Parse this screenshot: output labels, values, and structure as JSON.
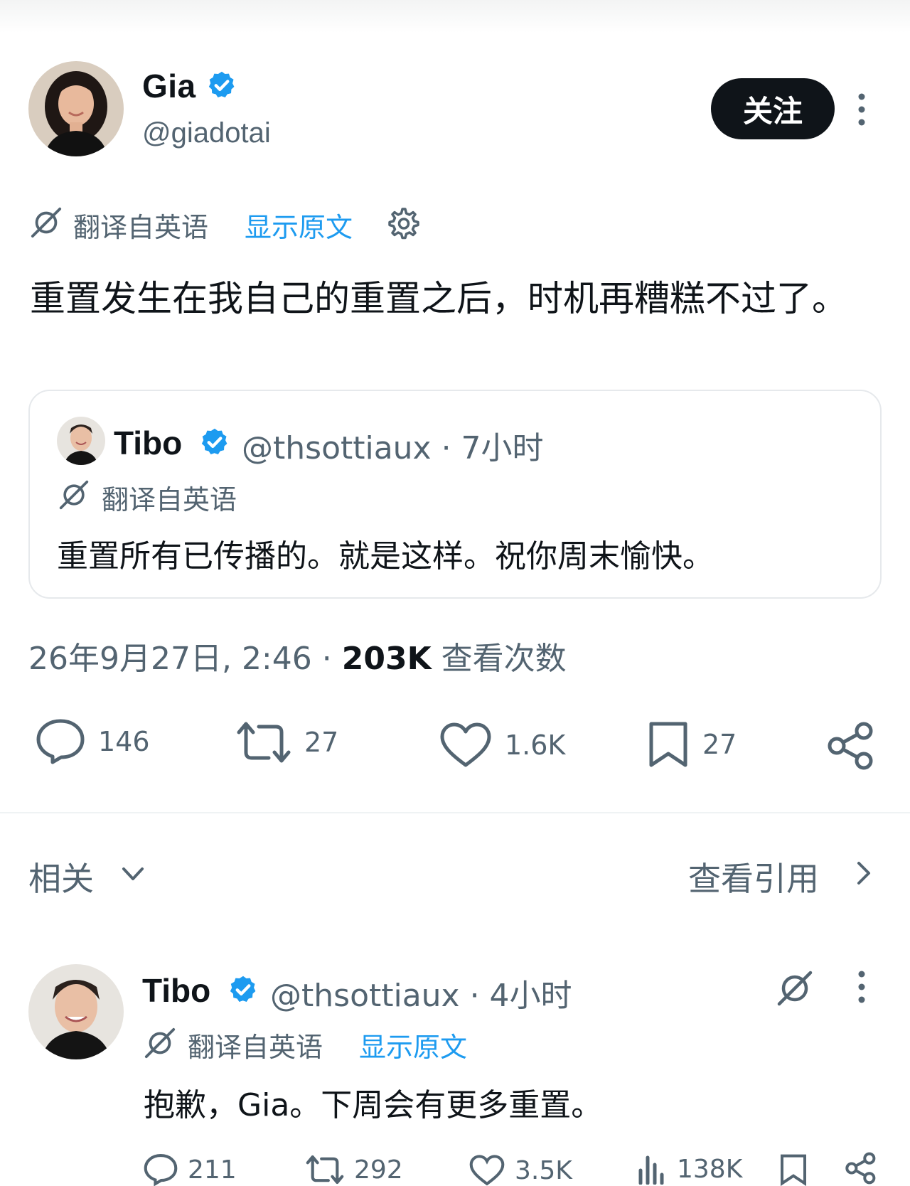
{
  "main_tweet": {
    "author_name": "Gia",
    "author_handle": "@giadotai",
    "follow_label": "关注",
    "translated_label": "翻译自英语",
    "show_original_label": "显示原文",
    "text": "重置发生在我自己的重置之后，时机再糟糕不过了。",
    "timestamp": "26年9月27日, 2:46",
    "separator": " · ",
    "views_count": "203K",
    "views_label": " 查看次数",
    "actions": {
      "replies": "146",
      "retweets": "27",
      "likes": "1.6K",
      "bookmarks": "27"
    }
  },
  "quoted_tweet": {
    "author_name": "Tibo",
    "author_handle_time": "@thsottiaux · 7小时",
    "translated_label": "翻译自英语",
    "text": "重置所有已传播的。就是这样。祝你周末愉快。"
  },
  "related": {
    "label": "相关",
    "view_quotes_label": "查看引用"
  },
  "reply": {
    "author_name": "Tibo",
    "author_handle_time": "@thsottiaux · 4小时",
    "translated_label": "翻译自英语",
    "show_original_label": "显示原文",
    "text": "抱歉，Gia。下周会有更多重置。",
    "actions": {
      "replies": "211",
      "retweets": "292",
      "likes": "3.5K",
      "views": "138K"
    }
  },
  "colors": {
    "text_primary": "#0f1419",
    "text_secondary": "#536471",
    "link_blue": "#1d9bf0",
    "border": "#e6e9ec"
  },
  "icons": [
    "verified-badge-icon",
    "more-vertical-icon",
    "translate-icon",
    "gear-icon",
    "reply-icon",
    "retweet-icon",
    "like-icon",
    "bookmark-icon",
    "share-icon",
    "chevron-down-icon",
    "chevron-right-icon",
    "views-icon",
    "grok-icon"
  ]
}
